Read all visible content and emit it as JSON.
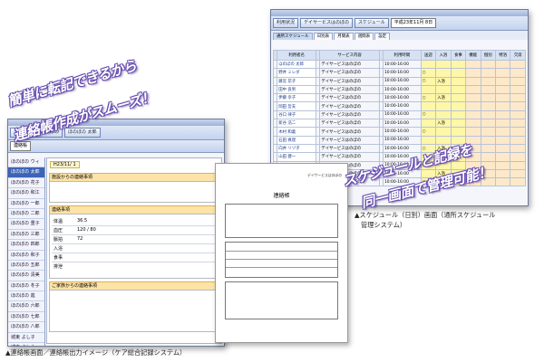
{
  "headlines": {
    "left_line1": "簡単に転記できるから",
    "left_line2": "連絡帳作成がスムーズ！",
    "right_line1": "スケジュールと記録を",
    "right_line2": "同一画面で管理可能！"
  },
  "captions": {
    "care": "▲連絡帳画面／連絡帳出力イメージ（ケア総合記録システム）",
    "schedule_line1": "▲スケジュール（日別）画面（通所スケジュール",
    "schedule_line2": "管理システム）"
  },
  "schedule_window": {
    "toolbar_buttons": [
      "利用状況",
      "デイサービスはのぼの",
      "スケジュール"
    ],
    "tabs": [
      "通所スケジュール",
      "日別表",
      "月間表",
      "週間表",
      "設定"
    ],
    "date_select": "平成23年11月 8日",
    "columns": [
      "",
      "利用者名",
      "",
      "サービス内容",
      "",
      "利用時間",
      "送迎",
      "入浴",
      "食事",
      "機能",
      "個別",
      "特浴",
      "欠席"
    ],
    "rows": [
      [
        "",
        "ほのぼの 太郎",
        "",
        "デイサービスはのぼの",
        "",
        "10:00-16:00",
        "",
        "",
        "",
        "",
        "",
        "",
        ""
      ],
      [
        "",
        "野井 ミレダ",
        "",
        "デイサービスはのぼの",
        "",
        "10:00-16:00",
        "○",
        "",
        "",
        "",
        "",
        "",
        ""
      ],
      [
        "",
        "藤宮 花子",
        "",
        "デイサービスはのぼの",
        "",
        "10:00-16:00",
        "○",
        "入浴",
        "",
        "",
        "",
        "",
        ""
      ],
      [
        "",
        "田中 良男",
        "",
        "デイサービスはのぼの",
        "",
        "10:00-16:00",
        "",
        "",
        "",
        "",
        "",
        "",
        ""
      ],
      [
        "",
        "伊藤 幸子",
        "",
        "デイサービスはのぼの",
        "",
        "10:00-16:00",
        "○",
        "入浴",
        "",
        "",
        "",
        "",
        ""
      ],
      [
        "",
        "岡田 哲夫",
        "",
        "デイサービスはのぼの",
        "",
        "10:00-16:00",
        "",
        "",
        "",
        "",
        "",
        "",
        ""
      ],
      [
        "",
        "谷口 律子",
        "",
        "デイサービスはのぼの",
        "",
        "10:00-16:00",
        "○",
        "",
        "",
        "",
        "",
        "",
        ""
      ],
      [
        "",
        "新谷 浩二",
        "",
        "デイサービスはのぼの",
        "",
        "10:00-16:00",
        "",
        "入浴",
        "",
        "",
        "",
        "",
        ""
      ],
      [
        "",
        "木村 和義",
        "",
        "デイサービスはのぼの",
        "",
        "10:00-16:00",
        "○",
        "",
        "",
        "",
        "",
        "",
        ""
      ],
      [
        "",
        "石田 真理",
        "",
        "デイサービスはのぼの",
        "",
        "10:00-16:00",
        "",
        "",
        "",
        "",
        "",
        "",
        ""
      ],
      [
        "",
        "向井 リヅ子",
        "",
        "デイサービスはのぼの",
        "",
        "10:00-16:00",
        "○",
        "入浴",
        "",
        "",
        "",
        "",
        ""
      ],
      [
        "",
        "山田 健一",
        "",
        "デイサービスはのぼの",
        "",
        "10:00-16:00",
        "",
        "",
        "",
        "",
        "",
        "",
        ""
      ],
      [
        "",
        "斉藤 雅子",
        "",
        "デイサービスはのぼの",
        "",
        "10:00-16:00",
        "○",
        "",
        "",
        "",
        "",
        "",
        ""
      ],
      [
        "",
        "上野 靖子",
        "",
        "デイサービスはのぼの",
        "",
        "10:00-16:00",
        "",
        "入浴",
        "",
        "",
        "",
        "",
        ""
      ],
      [
        "",
        "大塚 栄治",
        "",
        "デイサービスはのぼの",
        "",
        "10:00-16:00",
        "○",
        "",
        "",
        "",
        "",
        "",
        ""
      ]
    ]
  },
  "care_window": {
    "toolbar_buttons": [
      "デイサービスはのぼの",
      "ほのぼの 太郎"
    ],
    "form_title": "連絡帳",
    "date_value": "H23/11/ 1",
    "section_heads": [
      "施設からの連絡事項",
      "連絡事項",
      "ご家族からの連絡事項"
    ],
    "sidebar_items": [
      "ほのぼの ウィ",
      "ほのぼの 太郎",
      "ほのぼの 花子",
      "ほのぼの 和江",
      "ほのぼの 一郎",
      "ほのぼの 二郎",
      "ほのぼの 重子",
      "ほのぼの 三郎",
      "ほのぼの 四郎",
      "ほのぼの 和子",
      "ほのぼの 五郎",
      "ほのぼの 清美",
      "ほのぼの 冬子",
      "ほのぼの 進",
      "ほのぼの 六郎",
      "ほのぼの 七郎",
      "ほのぼの 八郎",
      "城東 よし子",
      "城東 よしえ"
    ],
    "vital_labels": [
      "体温",
      "血圧",
      "脈拍",
      "入浴",
      "食事",
      "排泄"
    ],
    "vital_values": [
      "36.5",
      "120 / 80",
      "72"
    ]
  },
  "paper": {
    "title": "連絡帳",
    "header_note": "デイサービスはのぼの"
  }
}
